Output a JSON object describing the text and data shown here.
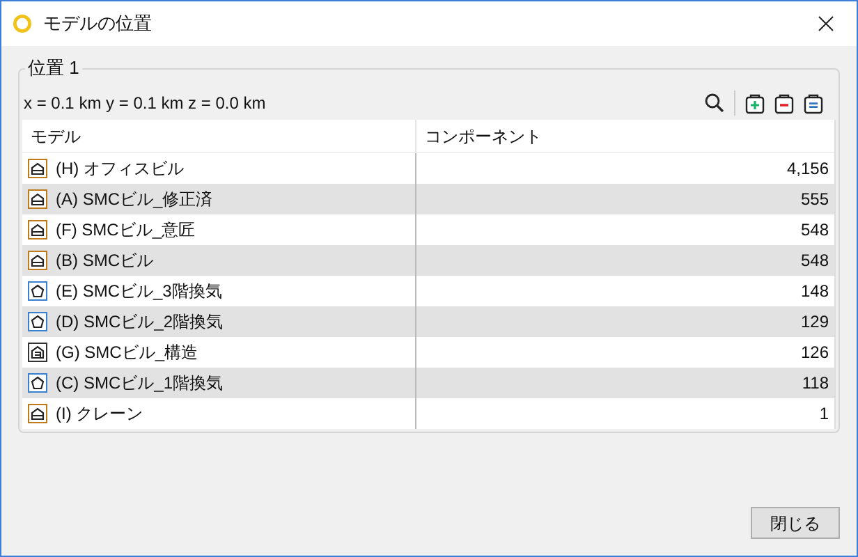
{
  "window": {
    "title": "モデルの位置"
  },
  "group": {
    "title": "位置 1",
    "coordinates": "x = 0.1 km y = 0.1 km z = 0.0 km"
  },
  "table": {
    "columns": [
      "モデル",
      "コンポーネント"
    ],
    "rows": [
      {
        "kind": "house",
        "model": "(H) オフィスビル",
        "components": "4,156"
      },
      {
        "kind": "house",
        "model": "(A) SMCビル_修正済",
        "components": "555"
      },
      {
        "kind": "house",
        "model": "(F) SMCビル_意匠",
        "components": "548"
      },
      {
        "kind": "house",
        "model": "(B) SMCビル",
        "components": "548"
      },
      {
        "kind": "pentagon",
        "model": "(E) SMCビル_3階換気",
        "components": "148"
      },
      {
        "kind": "pentagon",
        "model": "(D) SMCビル_2階換気",
        "components": "129"
      },
      {
        "kind": "structure",
        "model": "(G) SMCビル_構造",
        "components": "126"
      },
      {
        "kind": "pentagon",
        "model": "(C) SMCビル_1階換気",
        "components": "118"
      },
      {
        "kind": "house",
        "model": "(I) クレーン",
        "components": "1"
      }
    ]
  },
  "buttons": [
    "閉じる"
  ]
}
